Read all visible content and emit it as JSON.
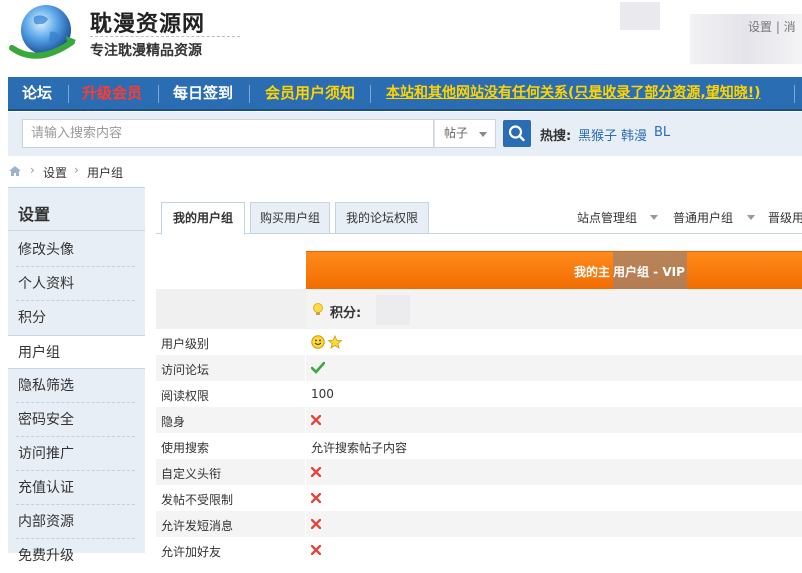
{
  "header": {
    "site_title": "耽漫资源网",
    "site_subtitle": "专注耽漫精品资源",
    "top_right_link": "设置 | 消"
  },
  "nav": {
    "items": [
      {
        "label": "论坛",
        "color": "#ffffff"
      },
      {
        "label": "升级会员",
        "color": "#ff3b30"
      },
      {
        "label": "每日签到",
        "color": "#ffffff"
      },
      {
        "label": "会员用户须知",
        "color": "#ffd400"
      },
      {
        "label": "本站和其他网站没有任何关系(只是收录了部分资源,望知晓!)",
        "color": "#ffd400"
      }
    ]
  },
  "search": {
    "placeholder": "请输入搜索内容",
    "scope": "帖子",
    "hot_label": "热搜:",
    "hot_terms": [
      "黑猴子",
      "韩漫",
      "BL"
    ]
  },
  "breadcrumb": [
    "设置",
    "用户组"
  ],
  "sidebar": {
    "title": "设置",
    "items": [
      {
        "label": "修改头像"
      },
      {
        "label": "个人资料"
      },
      {
        "label": "积分"
      },
      {
        "label": "用户组"
      },
      {
        "label": "隐私筛选"
      },
      {
        "label": "密码安全"
      },
      {
        "label": "访问推广"
      },
      {
        "label": "充值认证"
      },
      {
        "label": "内部资源"
      },
      {
        "label": "免费升级"
      }
    ],
    "active_index": 3
  },
  "tabs": [
    "我的用户组",
    "购买用户组",
    "我的论坛权限"
  ],
  "dropdowns": [
    "站点管理组",
    "普通用户组",
    "晋级用户组"
  ],
  "group_banner": {
    "text_left": "我的主",
    "text_right": "用户组 - VIP",
    "accent_color": "#f57a0a"
  },
  "credits_label": "积分:",
  "permissions": [
    {
      "key": "用户级别",
      "type": "stars",
      "icon": "smile-star-icon"
    },
    {
      "key": "访问论坛",
      "type": "yes",
      "icon": "check-icon"
    },
    {
      "key": "阅读权限",
      "type": "text",
      "value": "100"
    },
    {
      "key": "隐身",
      "type": "no",
      "icon": "cross-icon"
    },
    {
      "key": "使用搜索",
      "type": "text",
      "value": "允许搜索帖子内容"
    },
    {
      "key": "自定义头衔",
      "type": "no",
      "icon": "cross-icon"
    },
    {
      "key": "发帖不受限制",
      "type": "no",
      "icon": "cross-icon"
    },
    {
      "key": "允许发短消息",
      "type": "no",
      "icon": "cross-icon"
    },
    {
      "key": "允许加好友",
      "type": "no",
      "icon": "cross-icon"
    }
  ]
}
